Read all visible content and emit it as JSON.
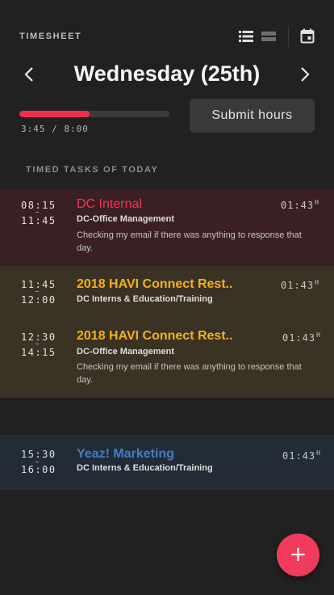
{
  "header": {
    "title": "TIMESHEET",
    "icons": [
      "list-view-icon",
      "compact-view-icon",
      "calendar-icon"
    ]
  },
  "date_nav": {
    "date": "Wednesday (25th)",
    "prev_icon": "chevron-left-icon",
    "next_icon": "chevron-right-icon"
  },
  "progress": {
    "text": "3:45 / 8:00",
    "fraction": 0.47,
    "color": "#ef2b4e"
  },
  "submit_label": "Submit hours",
  "section_title": "TIMED TASKS OF TODAY",
  "tasks": [
    {
      "start": "08:15",
      "end": "11:45",
      "title": "DC Internal",
      "category": "DC-Office Management",
      "description": "Checking my email if there was anything to response that day.",
      "duration": "01:43",
      "duration_unit": "H",
      "color": "#f0365a"
    },
    {
      "start": "11:45",
      "end": "12:00",
      "title": "2018 HAVI Connect Rest..",
      "category": "DC Interns & Education/Training",
      "description": "",
      "duration": "01:43",
      "duration_unit": "H",
      "color": "#f2b01e"
    },
    {
      "start": "12:30",
      "end": "14:15",
      "title": "2018 HAVI Connect Rest..",
      "category": "DC-Office Management",
      "description": "Checking my email if there was anything to response that day.",
      "duration": "01:43",
      "duration_unit": "H",
      "color": "#f2b01e"
    },
    {
      "start": "15:30",
      "end": "16:00",
      "title": "Yeaz! Marketing",
      "category": "DC Interns & Education/Training",
      "description": "",
      "duration": "01:43",
      "duration_unit": "H",
      "color": "#3f7fc5"
    }
  ],
  "fab_label": "+",
  "fab_icon": "plus-icon"
}
